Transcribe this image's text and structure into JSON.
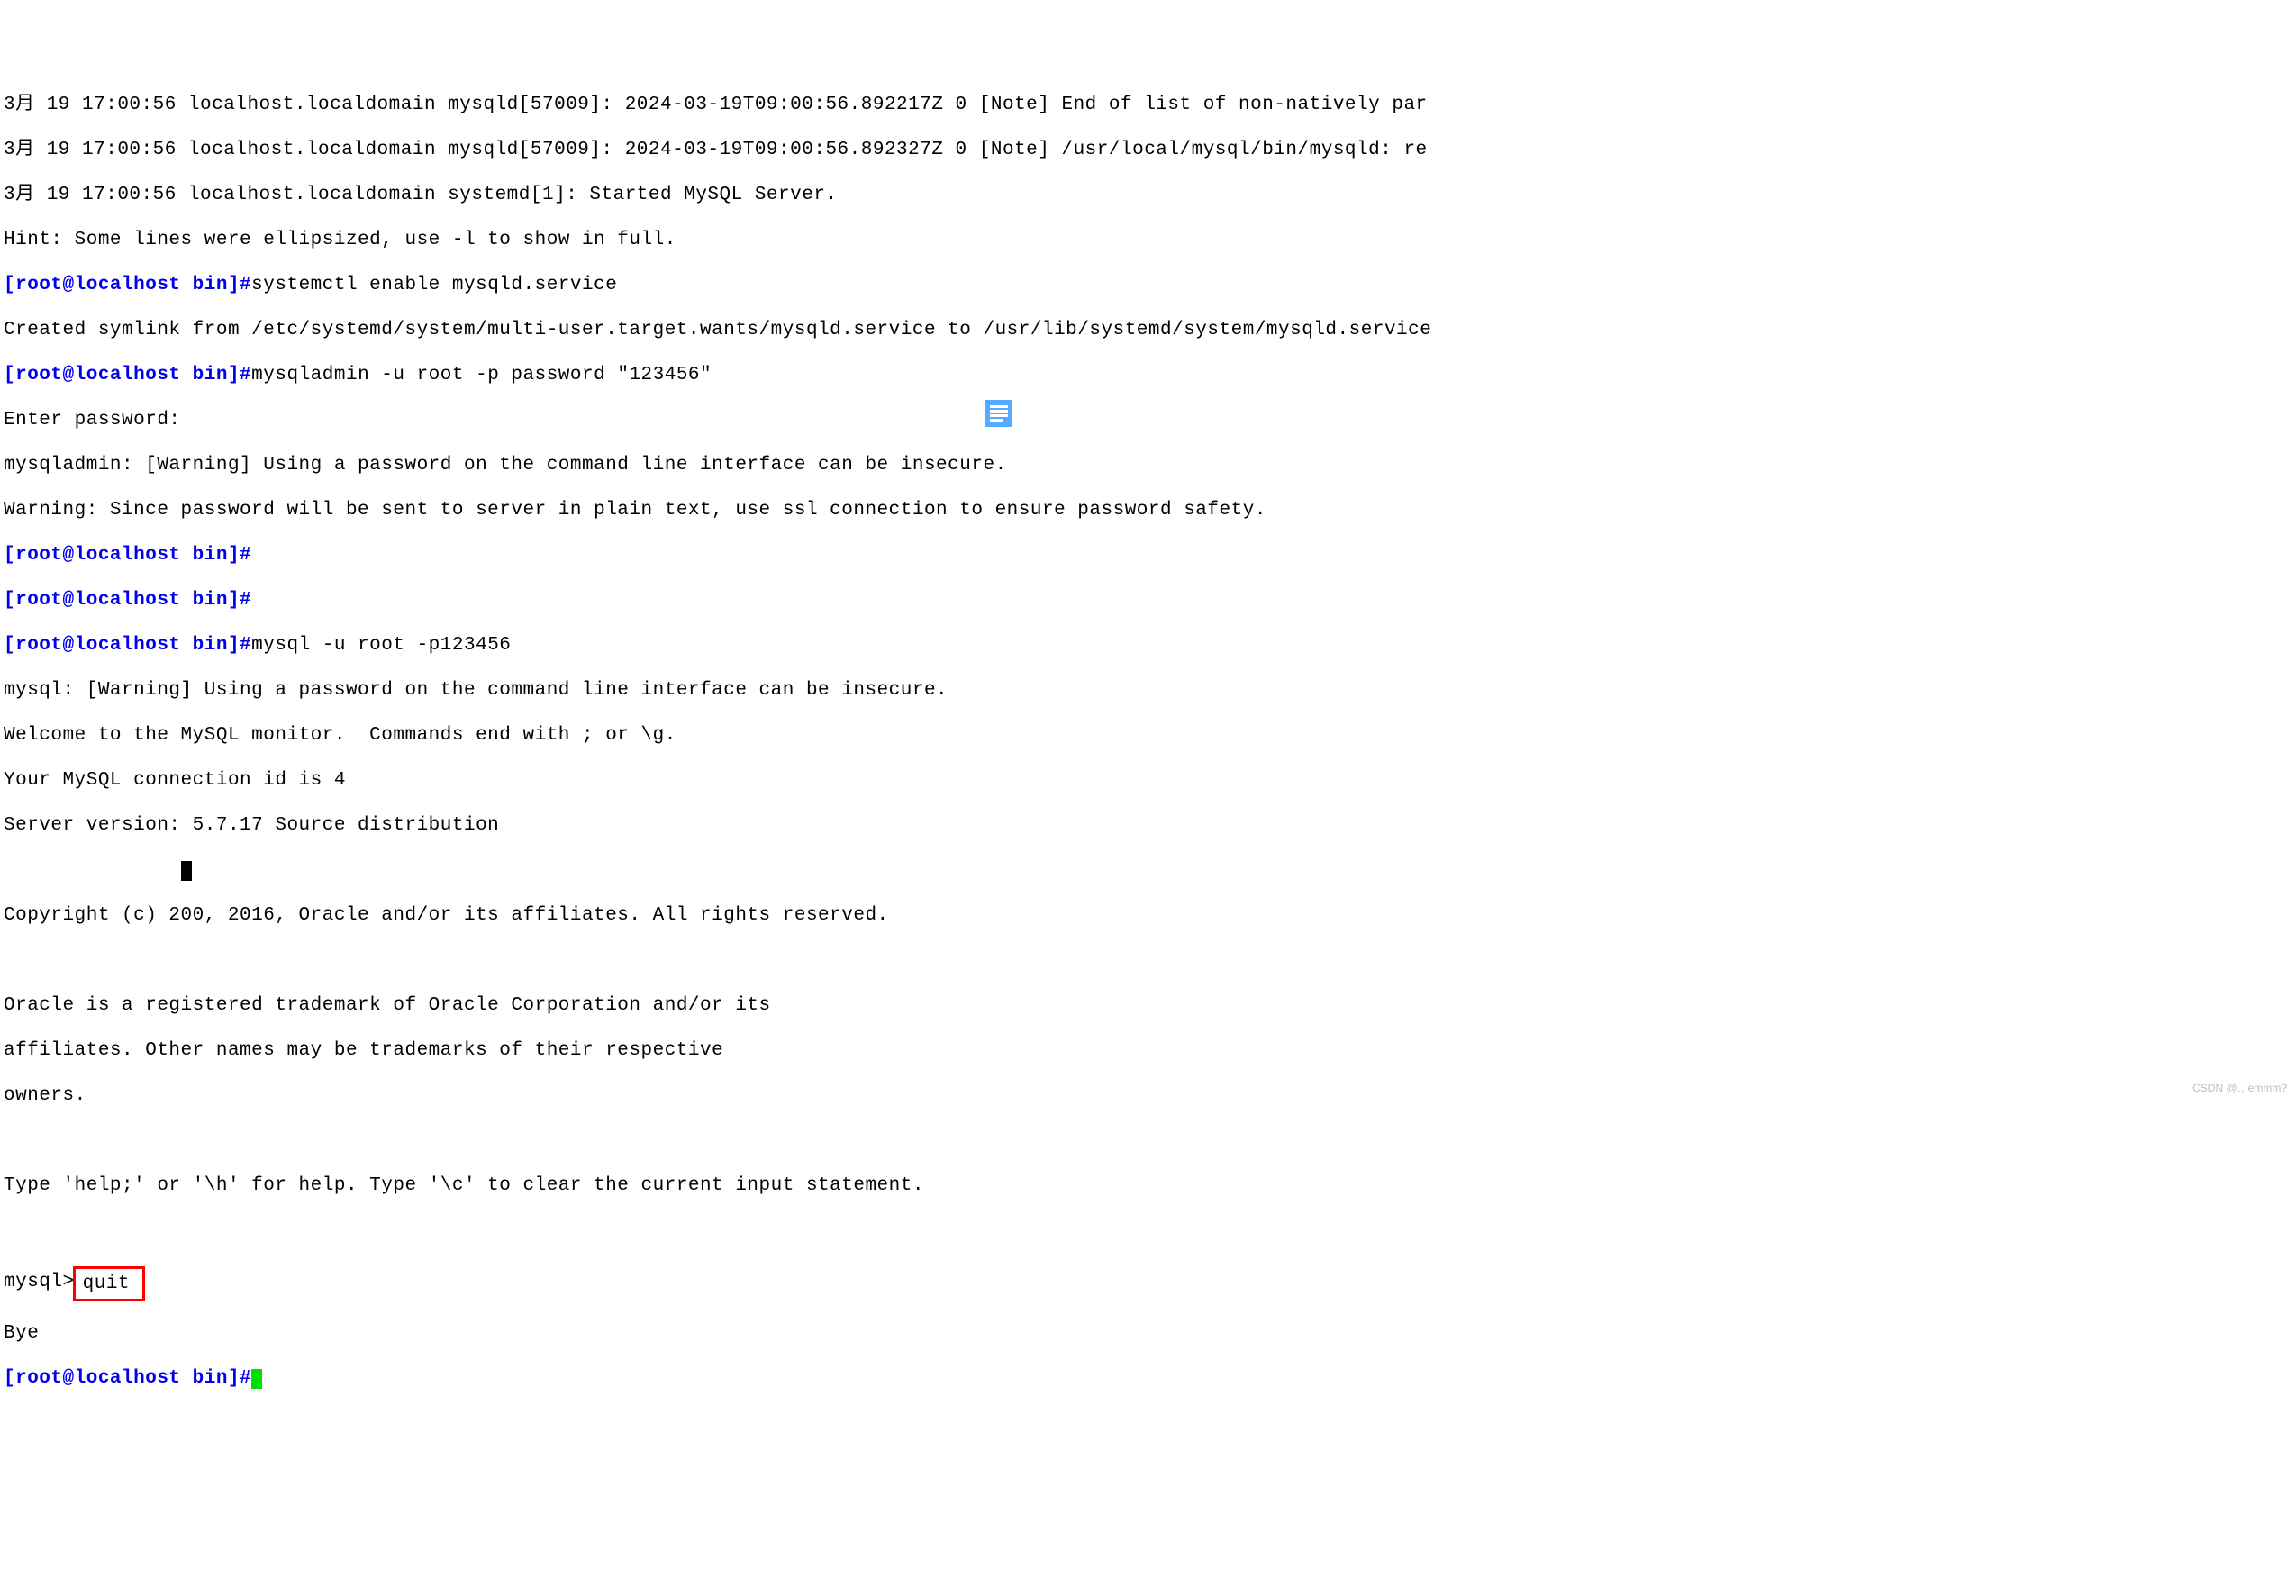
{
  "lines": {
    "l1": "3月 19 17:00:56 localhost.localdomain mysqld[57009]: 2024-03-19T09:00:56.892217Z 0 [Note] End of list of non-natively par",
    "l2": "3月 19 17:00:56 localhost.localdomain mysqld[57009]: 2024-03-19T09:00:56.892327Z 0 [Note] /usr/local/mysql/bin/mysqld: re",
    "l3": "3月 19 17:00:56 localhost.localdomain systemd[1]: Started MySQL Server.",
    "l4": "Hint: Some lines were ellipsized, use -l to show in full."
  },
  "prompts": {
    "p1": "[root@localhost bin]#",
    "p2": "[root@localhost bin]#",
    "p3": "[root@localhost bin]#",
    "p4": "[root@localhost bin]#",
    "p5": "[root@localhost bin]#",
    "p6": "[root@localhost bin]#"
  },
  "cmds": {
    "c1": "systemctl enable mysqld.service",
    "c2": "mysqladmin -u root -p password \"123456\"",
    "c3": "mysql -u root -p123456"
  },
  "out": {
    "o1": "Created symlink from /etc/systemd/system/multi-user.target.wants/mysqld.service to /usr/lib/systemd/system/mysqld.service",
    "o2": "Enter password:",
    "o3": "mysqladmin: [Warning] Using a password on the command line interface can be insecure.",
    "o4": "Warning: Since password will be sent to server in plain text, use ssl connection to ensure password safety.",
    "o5": "mysql: [Warning] Using a password on the command line interface can be insecure.",
    "o6": "Welcome to the MySQL monitor.  Commands end with ; or \\g.",
    "o7": "Your MySQL connection id is 4",
    "o8": "Server version: 5.7.17 Source distribution",
    "o10a": "Copyright (c) 2",
    "o10b": "00, 2016, Oracle and/or its affiliates. All rights reserved.",
    "o12": "Oracle is a registered trademark of Oracle Corporation and/or its",
    "o13": "affiliates. Other names may be trademarks of their respective",
    "o14": "owners.",
    "o16": "Type 'help;' or '\\h' for help. Type '\\c' to clear the current input statement."
  },
  "mysql": {
    "prompt": "mysql>",
    "quit": "quit",
    "bye": "Bye"
  },
  "watermark": "CSDN @…emmm?"
}
